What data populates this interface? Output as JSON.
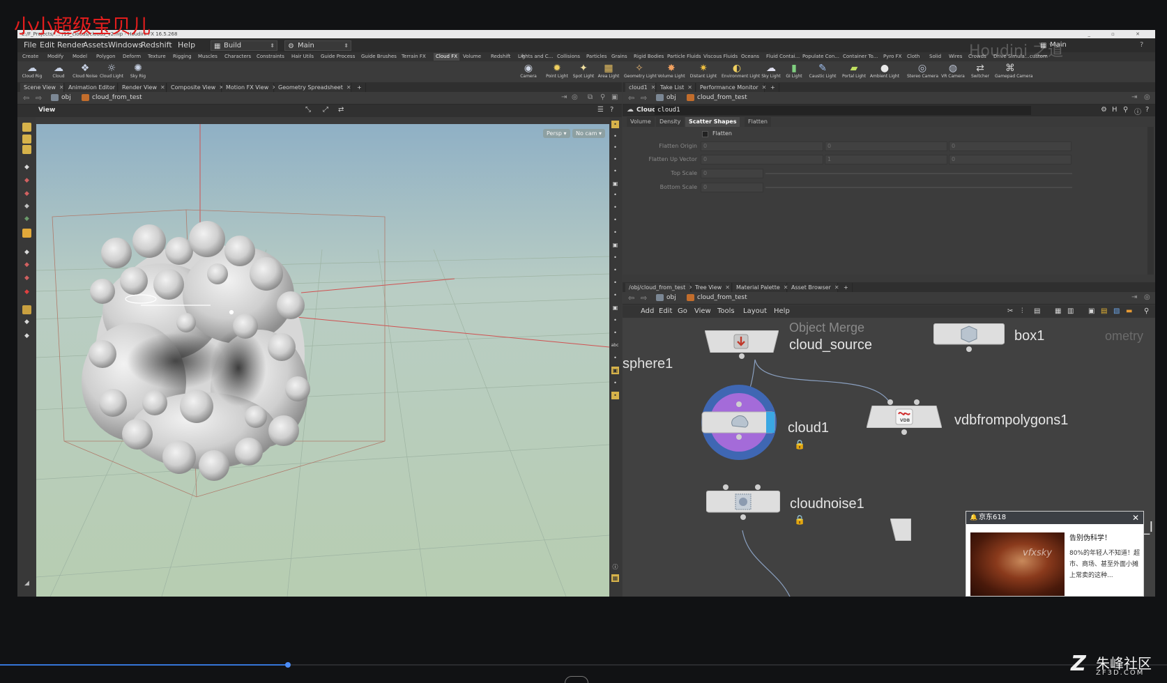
{
  "overlay_title": "小小超级宝贝儿",
  "window": {
    "title": "E:/F_Projects/ ... /19_clouds/clouds_v2.hip - Houdini FX 16.5.268",
    "controls": "_ ▫ ✕"
  },
  "menu": [
    "File",
    "Edit",
    "Render",
    "Assets",
    "Windows",
    "Redshift",
    "Help"
  ],
  "desktop_selector": "Build",
  "main_selector": "Main",
  "main_selector_right": "Main",
  "shelf_tabs_left": [
    "Create",
    "Modify",
    "Model",
    "Polygon",
    "Deform",
    "Texture",
    "Rigging",
    "Muscles",
    "Characters",
    "Constraints",
    "Hair Utils",
    "Guide Process",
    "Guide Brushes",
    "Terrain FX",
    "Cloud FX",
    "Volume",
    "Redshift"
  ],
  "shelf_tabs_left_active": "Cloud FX",
  "shelf_tabs_right": [
    "Lights and C...",
    "Collisions",
    "Particles",
    "Grains",
    "Rigid Bodies",
    "Particle Fluids",
    "Viscous Fluids",
    "Oceans",
    "Fluid Contai...",
    "Populate Con...",
    "Container To...",
    "Pyro FX",
    "Cloth",
    "Solid",
    "Wires",
    "Crowds",
    "Drive Simula...",
    "custom"
  ],
  "shelf_tools_left": [
    {
      "label": "Cloud Rig",
      "icon": "☁"
    },
    {
      "label": "Cloud",
      "icon": "☁"
    },
    {
      "label": "Cloud Noise",
      "icon": "❖"
    },
    {
      "label": "Cloud Light",
      "icon": "☼"
    },
    {
      "label": "Sky Rig",
      "icon": "✺"
    }
  ],
  "shelf_tools_right": [
    {
      "label": "Camera",
      "icon": "◉"
    },
    {
      "label": "Point Light",
      "icon": "✹"
    },
    {
      "label": "Spot Light",
      "icon": "✦"
    },
    {
      "label": "Area Light",
      "icon": "▦"
    },
    {
      "label": "Geometry Light",
      "icon": "✧"
    },
    {
      "label": "Volume Light",
      "icon": "✸"
    },
    {
      "label": "Distant Light",
      "icon": "✷"
    },
    {
      "label": "Environment Light",
      "icon": "◐"
    },
    {
      "label": "Sky Light",
      "icon": "☁"
    },
    {
      "label": "GI Light",
      "icon": "▮"
    },
    {
      "label": "Caustic Light",
      "icon": "✎"
    },
    {
      "label": "Portal Light",
      "icon": "▰"
    },
    {
      "label": "Ambient Light",
      "icon": "●"
    },
    {
      "label": "Stereo Camera",
      "icon": "◎"
    },
    {
      "label": "VR Camera",
      "icon": "◍"
    },
    {
      "label": "Switcher",
      "icon": "⇄"
    },
    {
      "label": "Gamepad Camera",
      "icon": "⌘"
    }
  ],
  "left_pane_tabs": [
    "Scene View",
    "Animation Editor",
    "Render View",
    "Composite View",
    "Motion FX View",
    "Geometry Spreadsheet"
  ],
  "path": {
    "root": "obj",
    "node": "cloud_from_test"
  },
  "viewer": {
    "title": "View",
    "persp": "Persp ▾",
    "cam": "No cam ▾"
  },
  "param_pane_tabs": [
    "cloud1",
    "Take List",
    "Performance Monitor"
  ],
  "param": {
    "type": "Cloud",
    "name": "cloud1",
    "tabs": [
      "Volume",
      "Density",
      "Scatter Shapes",
      "Flatten"
    ],
    "active_tab": "Scatter Shapes",
    "flatten_label": "Flatten",
    "rows": [
      {
        "label": "Flatten Origin",
        "values": [
          "0",
          "0",
          "0"
        ]
      },
      {
        "label": "Flatten Up Vector",
        "values": [
          "0",
          "1",
          "0"
        ]
      },
      {
        "label": "Top Scale",
        "values": [
          "0"
        ]
      },
      {
        "label": "Bottom Scale",
        "values": [
          "0"
        ]
      }
    ]
  },
  "net_pane_tabs": [
    "/obj/cloud_from_test",
    "Tree View",
    "Material Palette",
    "Asset Browser"
  ],
  "net_menu": [
    "Add",
    "Edit",
    "Go",
    "View",
    "Tools",
    "Layout",
    "Help"
  ],
  "nodes": {
    "sphere": "sphere1",
    "object_merge_type": "Object Merge",
    "cloud_source": "cloud_source",
    "box": "box1",
    "box_type": "ometry",
    "cloud": "cloud1",
    "vdb": "vdbfrompolygons1",
    "vdb_icon": "VDB",
    "cloudnoise": "cloudnoise1",
    "edge_fragment": "_l"
  },
  "ad": {
    "source": "京东618",
    "title": "告别伪科学！",
    "body": "80%的年轻人不知道！超市、商场、甚至外面小摊上常卖的这种...",
    "watermark": "vfxsky"
  },
  "watermark_top": "Houdini 之道",
  "logo": {
    "mark": "Z",
    "text": "朱峰社区",
    "sub": "ZF3D.COM"
  },
  "playback": {
    "progress_fraction": 0.247
  }
}
